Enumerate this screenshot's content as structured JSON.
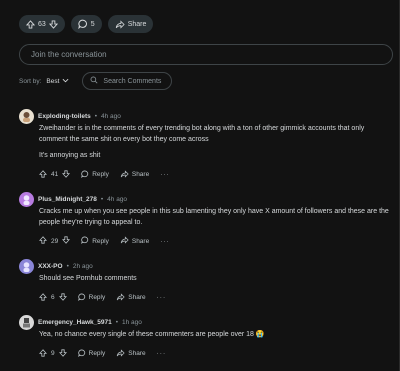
{
  "post_actions": {
    "vote_count": "63",
    "comment_count": "5",
    "share_label": "Share"
  },
  "join": {
    "placeholder": "Join the conversation"
  },
  "sort": {
    "label": "Sort by:",
    "value": "Best",
    "search_placeholder": "Search Comments"
  },
  "comments": [
    {
      "author": "Exploding-toilets",
      "time": "4h ago",
      "paragraphs": [
        "Zweihander is in the comments of every trending bot along with a ton of other gimmick accounts that only comment the same shit on every bot they come across",
        "It's annoying as shit"
      ],
      "votes": "41",
      "reply_label": "Reply",
      "share_label": "Share",
      "avatar_color": "#e8e0d0"
    },
    {
      "author": "Plus_Midnight_278",
      "time": "4h ago",
      "paragraphs": [
        "Cracks me up when you see people in this sub lamenting they only have X amount of followers and these are the people they're trying to appeal to."
      ],
      "votes": "29",
      "reply_label": "Reply",
      "share_label": "Share",
      "avatar_color": "#b77be0"
    },
    {
      "author": "XXX-PO",
      "time": "2h ago",
      "paragraphs": [
        "Should see Pornhub comments"
      ],
      "votes": "6",
      "reply_label": "Reply",
      "share_label": "Share",
      "avatar_color": "#8a86d8"
    },
    {
      "author": "Emergency_Hawk_5971",
      "time": "1h ago",
      "paragraphs": [
        "Yea, no chance every single of these commenters are people over 18 😭"
      ],
      "votes": "9",
      "reply_label": "Reply",
      "share_label": "Share",
      "avatar_color": "#d8d8d8"
    }
  ],
  "meta": {
    "separator": "•",
    "more": "···"
  }
}
